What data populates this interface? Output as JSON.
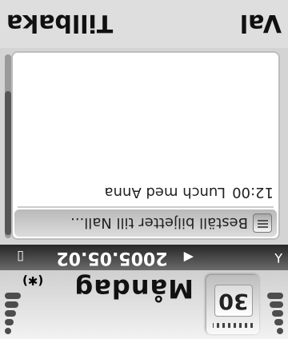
{
  "status": {
    "date_number": "30",
    "weekday": "Måndag",
    "bluetooth_icon": "(✱)"
  },
  "navigation": {
    "left_arrow": "◀",
    "right_arrow": "▶",
    "date": "2005.05.02"
  },
  "events": [
    {
      "icon": "memo-icon",
      "time": "",
      "title": "Beställ biljetter till Nall..."
    },
    {
      "icon": "",
      "time": "12:00",
      "title": "Lunch med Anna"
    }
  ],
  "softkeys": {
    "left": "Val",
    "right": "Tillbaka"
  }
}
